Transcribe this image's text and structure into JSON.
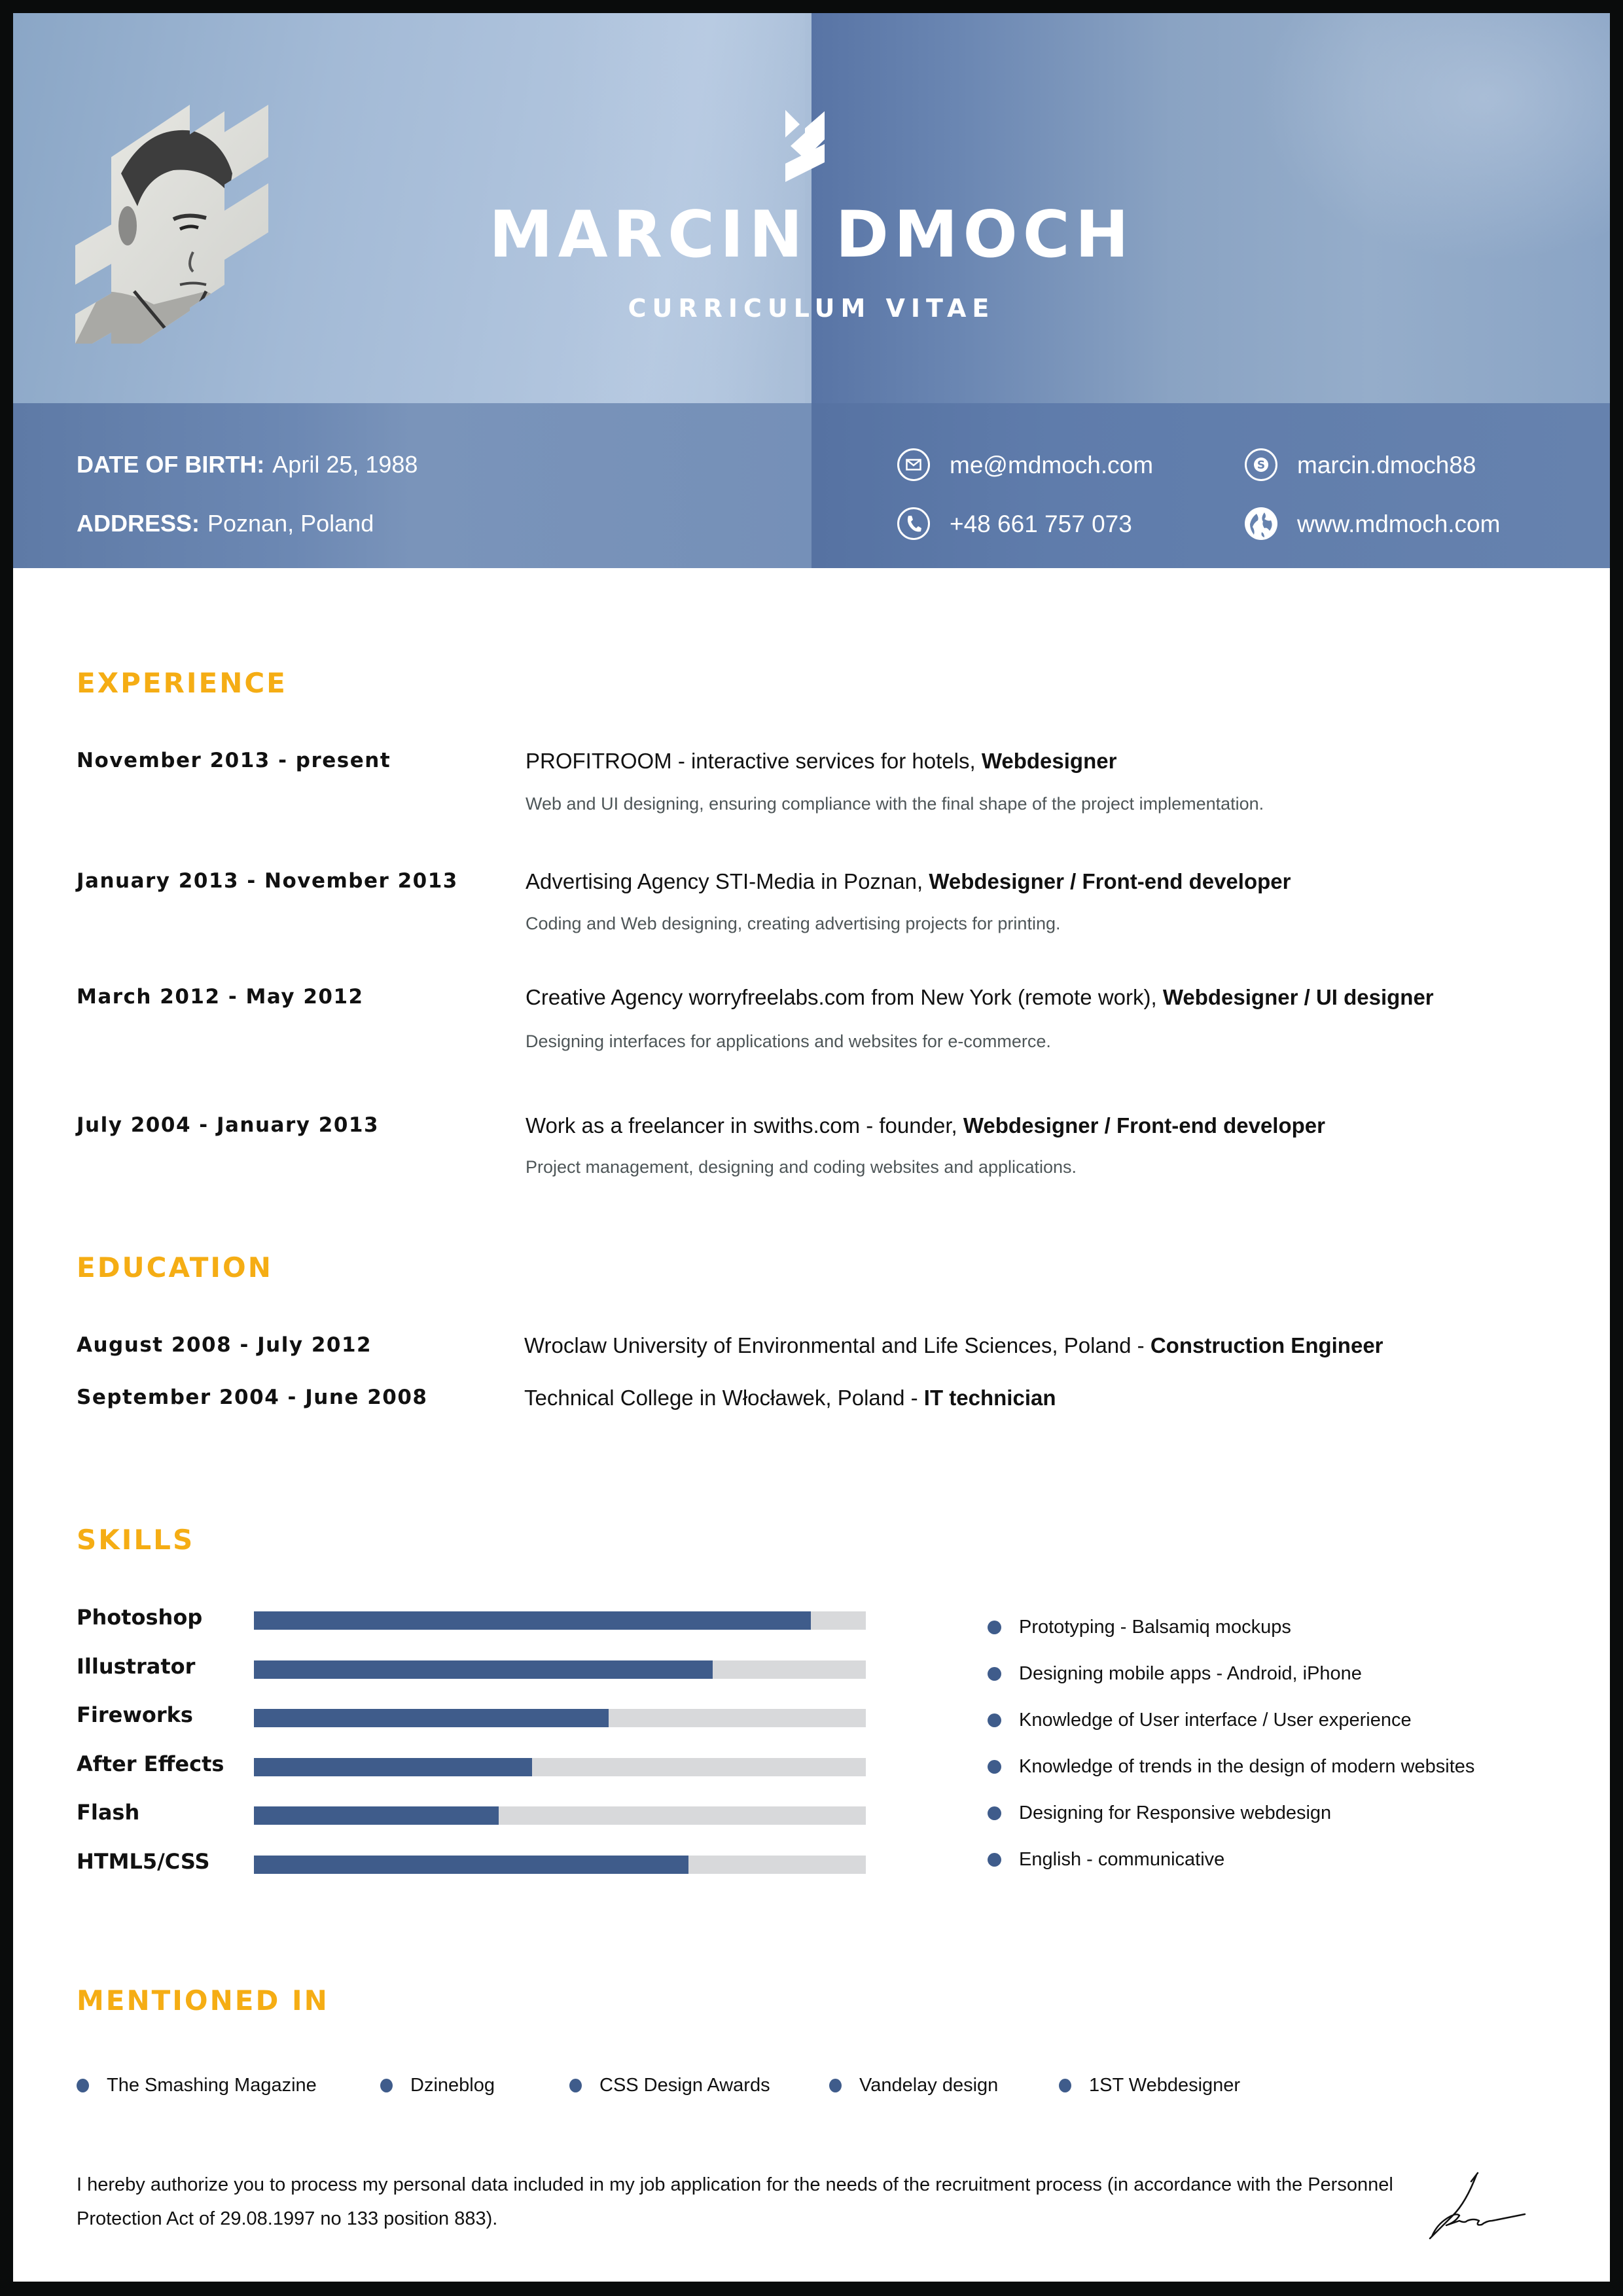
{
  "header": {
    "name": "MARCIN DMOCH",
    "subtitle": "CURRICULUM VITAE",
    "portrait_icon": "portrait-photo",
    "logo_icon": "chevron-logo"
  },
  "personal": {
    "dob_label": "DATE OF BIRTH:",
    "dob_value": "April 25, 1988",
    "address_label": "ADDRESS:",
    "address_value": "Poznan, Poland"
  },
  "contacts": [
    {
      "icon": "email-icon",
      "value": "me@mdmoch.com"
    },
    {
      "icon": "phone-icon",
      "value": "+48 661 757 073"
    },
    {
      "icon": "skype-icon",
      "value": "marcin.dmoch88"
    },
    {
      "icon": "globe-icon",
      "value": "www.mdmoch.com"
    }
  ],
  "colors": {
    "accent": "#f5ad14",
    "primary": "#3f5c8b",
    "bar_track": "#d8d9db",
    "header_blue": "#5d7aa8"
  },
  "experience": {
    "title": "EXPERIENCE",
    "items": [
      {
        "dates": "November 2013 - present",
        "company": "PROFITROOM - interactive services for hotels, ",
        "role": "Webdesigner",
        "description": "Web and UI designing, ensuring compliance with the final shape of the project implementation."
      },
      {
        "dates": "January 2013 - November 2013",
        "company": "Advertising Agency STI-Media in Poznan, ",
        "role": "Webdesigner / Front-end developer",
        "description": "Coding and Web designing, creating advertising projects for printing."
      },
      {
        "dates": "March 2012 - May 2012",
        "company": "Creative Agency worryfreelabs.com from New York (remote work), ",
        "role": "Webdesigner / UI designer",
        "description": "Designing interfaces for applications and websites for e-commerce."
      },
      {
        "dates": "July 2004 - January 2013",
        "company": "Work as a freelancer in swiths.com - founder, ",
        "role": "Webdesigner / Front-end developer",
        "description": "Project management, designing and coding websites and applications."
      }
    ]
  },
  "education": {
    "title": "EDUCATION",
    "items": [
      {
        "dates": "August 2008 - July 2012",
        "school": "Wroclaw University of Environmental and Life Sciences, Poland - ",
        "degree": "Construction Engineer"
      },
      {
        "dates": "September 2004 - June 2008",
        "school": "Technical College in Włocławek, Poland - ",
        "degree": "IT technician"
      }
    ]
  },
  "skills": {
    "title": "SKILLS",
    "bars": [
      {
        "name": "Photoshop",
        "level": 0.91
      },
      {
        "name": "Illustrator",
        "level": 0.75
      },
      {
        "name": "Fireworks",
        "level": 0.58
      },
      {
        "name": "After Effects",
        "level": 0.455
      },
      {
        "name": "Flash",
        "level": 0.4
      },
      {
        "name": "HTML5/CSS",
        "level": 0.71
      }
    ],
    "list": [
      "Prototyping - Balsamiq mockups",
      "Designing mobile apps - Android, iPhone",
      "Knowledge of User interface / User experience",
      "Knowledge of trends in the design of modern websites",
      "Designing for Responsive webdesign",
      "English - communicative"
    ]
  },
  "mentioned": {
    "title": "MENTIONED IN",
    "items": [
      "The Smashing Magazine",
      "Dzineblog",
      "CSS Design Awards",
      "Vandelay design",
      "1ST Webdesigner"
    ]
  },
  "footer": {
    "consent": "I hereby authorize you to process my personal data included in my job application for the needs of the recruitment process (in accordance with the Personnel Protection Act of 29.08.1997 no 133 position 883).",
    "signature_icon": "signature"
  }
}
